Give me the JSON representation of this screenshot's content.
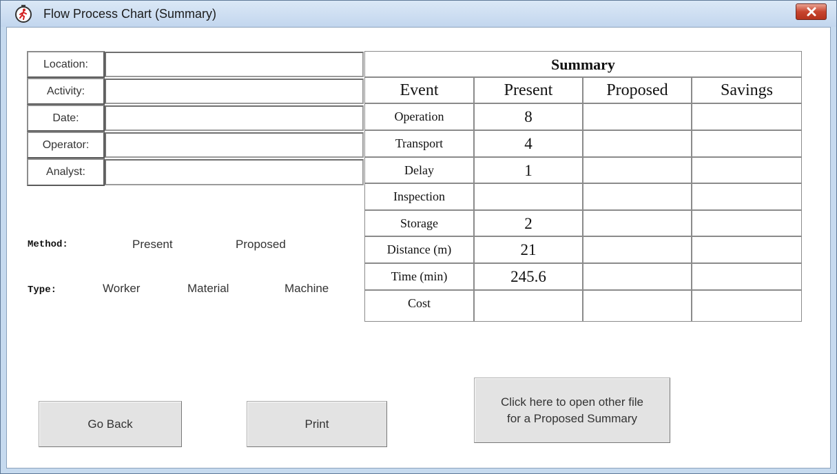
{
  "window": {
    "title": "Flow Process Chart (Summary)",
    "icon": "stopwatch-runner-icon",
    "close_icon": "close-x-icon"
  },
  "info_fields": [
    {
      "label": "Location:",
      "value": ""
    },
    {
      "label": "Activity:",
      "value": ""
    },
    {
      "label": "Date:",
      "value": ""
    },
    {
      "label": "Operator:",
      "value": ""
    },
    {
      "label": "Analyst:",
      "value": ""
    }
  ],
  "method": {
    "label": "Method:",
    "options": [
      "Present",
      "Proposed"
    ]
  },
  "type": {
    "label": "Type:",
    "options": [
      "Worker",
      "Material",
      "Machine"
    ]
  },
  "summary": {
    "title": "Summary",
    "headers": [
      "Event",
      "Present",
      "Proposed",
      "Savings"
    ],
    "rows": [
      {
        "event": "Operation",
        "present": "8",
        "proposed": "",
        "savings": ""
      },
      {
        "event": "Transport",
        "present": "4",
        "proposed": "",
        "savings": ""
      },
      {
        "event": "Delay",
        "present": "1",
        "proposed": "",
        "savings": ""
      },
      {
        "event": "Inspection",
        "present": "",
        "proposed": "",
        "savings": ""
      },
      {
        "event": "Storage",
        "present": "2",
        "proposed": "",
        "savings": ""
      },
      {
        "event": "Distance (m)",
        "present": "21",
        "proposed": "",
        "savings": ""
      },
      {
        "event": "Time (min)",
        "present": "245.6",
        "proposed": "",
        "savings": ""
      },
      {
        "event": "Cost",
        "present": "",
        "proposed": "",
        "savings": ""
      }
    ]
  },
  "buttons": {
    "go_back": "Go Back",
    "print": "Print",
    "open_other_line1": "Click here to open other file",
    "open_other_line2": "for a Proposed Summary"
  },
  "colors": {
    "titlebar": "#c2d6ee",
    "close_button": "#c7452f",
    "button_face": "#e3e3e3"
  }
}
